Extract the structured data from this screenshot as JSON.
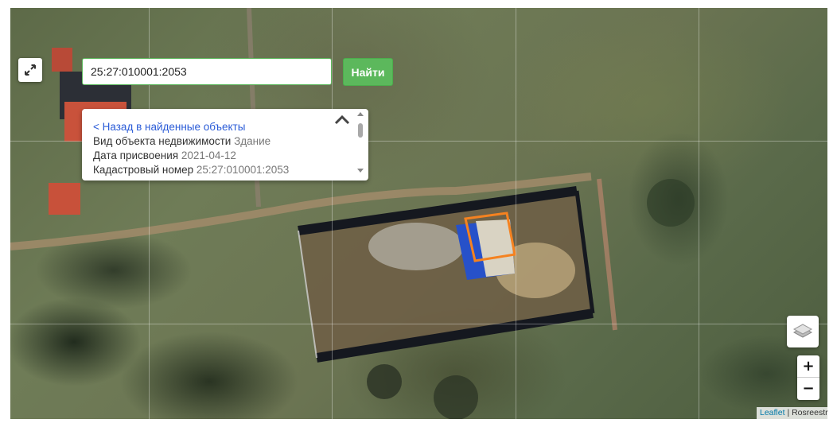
{
  "search": {
    "value": "25:27:010001:2053",
    "button_label": "Найти"
  },
  "popup": {
    "back_link": "< Назад в найденные объекты",
    "rows": [
      {
        "label": "Вид объекта недвижимости",
        "value": "Здание"
      },
      {
        "label": "Дата присвоения",
        "value": "2021-04-12"
      },
      {
        "label": "Кадастровый номер",
        "value": "25:27:010001:2053"
      }
    ]
  },
  "zoom": {
    "in_label": "+",
    "out_label": "−"
  },
  "attribution": {
    "link": "Leaflet",
    "separator": " | ",
    "source": "Rosreestr"
  },
  "icons": {
    "fullscreen": "expand-icon",
    "collapse": "chevron-up-icon",
    "layers": "layers-icon"
  },
  "colors": {
    "search_button": "#5cb85c",
    "search_border": "#5cb85c",
    "parcel_highlight": "#f58220",
    "link": "#2a5bd7"
  }
}
